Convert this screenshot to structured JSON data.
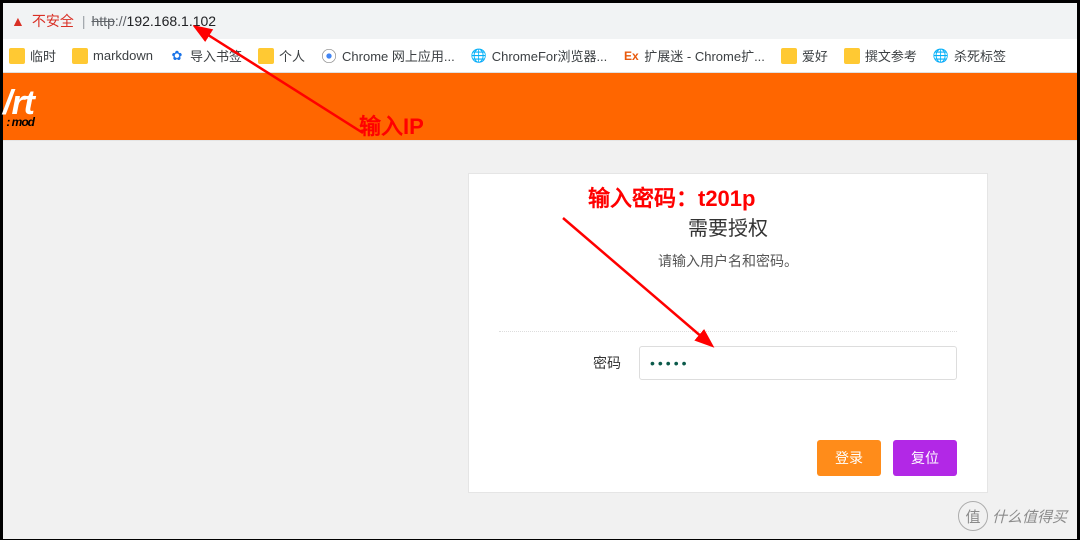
{
  "address_bar": {
    "warning_text": "不安全",
    "protocol": "http",
    "separator": "://",
    "ip": "192.168.1.102"
  },
  "bookmarks": [
    {
      "label": "临时",
      "icon": "folder"
    },
    {
      "label": "markdown",
      "icon": "folder"
    },
    {
      "label": "导入书签",
      "icon": "gear"
    },
    {
      "label": "个人",
      "icon": "folder"
    },
    {
      "label": "Chrome 网上应用...",
      "icon": "chrome"
    },
    {
      "label": "ChromeFor浏览器...",
      "icon": "globe"
    },
    {
      "label": "扩展迷 - Chrome扩...",
      "icon": "ex"
    },
    {
      "label": "爱好",
      "icon": "folder"
    },
    {
      "label": "撰文参考",
      "icon": "folder"
    },
    {
      "label": "杀死标签",
      "icon": "globe"
    }
  ],
  "logo": {
    "main": "/rt",
    "sub": ": mod"
  },
  "login": {
    "title": "需要授权",
    "subtitle": "请输入用户名和密码。",
    "password_label": "密码",
    "password_value": "•••••",
    "login_btn": "登录",
    "reset_btn": "复位"
  },
  "annotations": {
    "ip_hint": "输入IP",
    "pwd_hint": "输入密码：t201p"
  },
  "watermark": {
    "char": "值",
    "text": "什么值得买"
  },
  "colors": {
    "accent": "#ff6600",
    "danger": "#ff0000",
    "login_btn": "#ff8c1a",
    "reset_btn": "#b228e6"
  }
}
